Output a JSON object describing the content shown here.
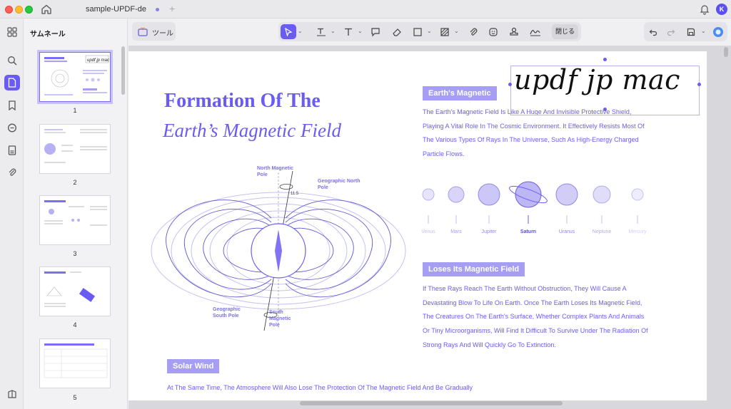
{
  "titlebar": {
    "tab_label": "sample-UPDF-de",
    "add_tab": "+",
    "avatar_initial": "K"
  },
  "rail": {
    "icons": [
      "grid-icon",
      "search-icon",
      "page-icon",
      "bookmark-icon",
      "comment-icon",
      "form-icon",
      "attachment-icon",
      "layers-icon"
    ]
  },
  "thumbnails": {
    "title": "サムネール",
    "pages": [
      {
        "number": "1"
      },
      {
        "number": "2"
      },
      {
        "number": "3"
      },
      {
        "number": "4"
      },
      {
        "number": "5"
      }
    ]
  },
  "toolbar": {
    "tools_label": "ツール",
    "close_label": "閉じる"
  },
  "document": {
    "title_line1": "Formation Of The",
    "title_line2": "Earth’s Magnetic Field",
    "signature": "updf jp mac",
    "section1_title": "Earth's Magnetic",
    "section1_text": "The Earth's Magnetic Field Is Like A Huge And Invisible Protective Shield, Playing A Vital Role In The Cosmic Environment. It Effectively Resists Most Of The Various Types Of Rays In The Universe, Such As High-Energy Charged Particle Flows.",
    "planets": [
      "Venus",
      "Mars",
      "Jupiter",
      "Saturn",
      "Uranus",
      "Neptune",
      "Mercury"
    ],
    "section2_title": "Loses Its Magnetic Field",
    "section2_text": "If These Rays Reach The Earth Without Obstruction, They Will Cause A Devastating Blow To Life On Earth. Once The Earth Loses Its Magnetic Field, The Creatures On The Earth's Surface, Whether Complex Plants And Animals Or Tiny Microorganisms, Will Find It Difficult To Survive Under The Radiation Of Strong Rays And Will Quickly Go To Extinction.",
    "section3_title": "Solar Wind",
    "section3_text": "At The Same Time, The Atmosphere Will Also Lose The Protection Of The Magnetic Field And Be Gradually",
    "diagram": {
      "north_magnetic": "North Magnetic Pole",
      "geo_north": "Geographic North Pole",
      "angle": "11.5",
      "geo_south": "Geographic South Pole",
      "south_magnetic": "South Magnetic Pole"
    }
  },
  "colors": {
    "accent": "#6a5cf2",
    "tag_bg": "#a59ef2"
  }
}
